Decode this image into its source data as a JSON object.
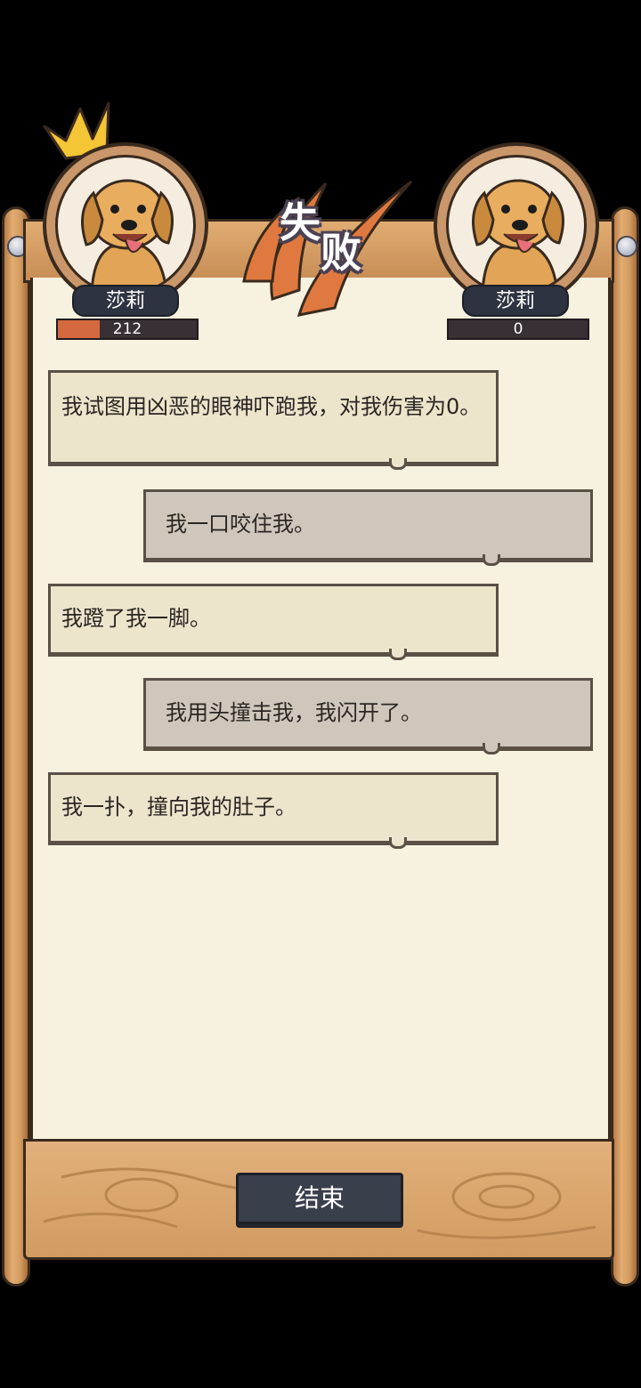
{
  "battle": {
    "result": "失败",
    "player": {
      "name": "莎莉",
      "hp": 212,
      "hp_fraction": 0.3
    },
    "opponent": {
      "name": "莎莉",
      "hp": 0,
      "hp_fraction": 0
    }
  },
  "log": [
    {
      "side": "left",
      "text": "我试图用凶恶的眼神吓跑我，对我伤害为0。"
    },
    {
      "side": "right",
      "text": "我一口咬住我。"
    },
    {
      "side": "left",
      "text": "我蹬了我一脚。"
    },
    {
      "side": "right",
      "text": "我用头撞击我，我闪开了。"
    },
    {
      "side": "left",
      "text": "我一扑，撞向我的肚子。"
    }
  ],
  "end_button_label": "结束",
  "colors": {
    "hp_fill": "#d4693f",
    "accent_orange": "#e0793f",
    "dark_slate": "#2d3340"
  },
  "icons": {
    "winner_marker": "crown-icon",
    "portrait": "golden-retriever-avatar"
  }
}
